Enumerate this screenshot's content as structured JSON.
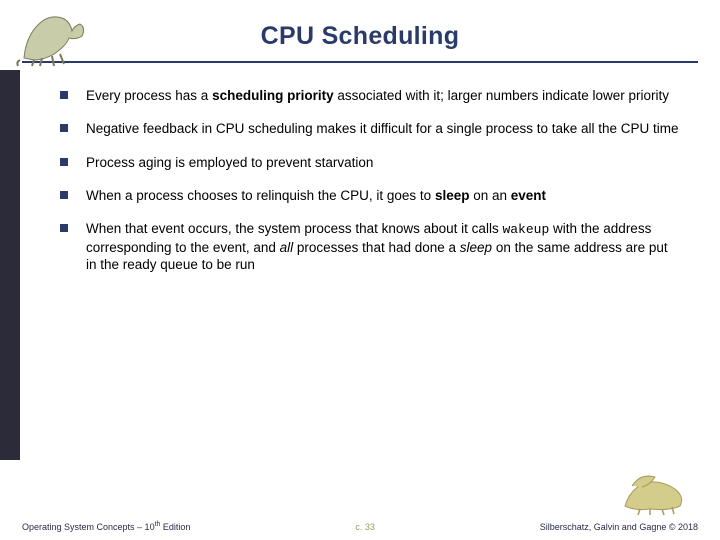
{
  "title": "CPU Scheduling",
  "bullets": {
    "b0": {
      "pre": "Every process has a ",
      "bold": "scheduling priority",
      "post": " associated with it; larger numbers indicate lower priority"
    },
    "b1": {
      "text": "Negative feedback in CPU scheduling makes it difficult for a single process to take all the CPU time"
    },
    "b2": {
      "text": "Process aging is employed to prevent starvation"
    },
    "b3": {
      "pre": "When a process chooses to relinquish the CPU, it goes to ",
      "bold1": "sleep",
      "mid": " on an ",
      "bold2": "event"
    },
    "b4": {
      "pre": "When that event occurs, the system process that knows about it calls ",
      "code": "wakeup",
      "mid": " with the address corresponding to the event, and ",
      "ital": "all",
      "post": " processes that had done a ",
      "ital2": "sleep",
      "tail": " on the same address are put in the ready queue to be run"
    }
  },
  "footer": {
    "left_pre": "Operating System Concepts – 10",
    "left_sup": "th",
    "left_post": " Edition",
    "center": "c. 33",
    "right": "Silberschatz, Galvin and Gagne © 2018"
  },
  "icons": {
    "dino_tl": "dinosaur-top-left",
    "dino_br": "dinosaur-bottom-right"
  }
}
